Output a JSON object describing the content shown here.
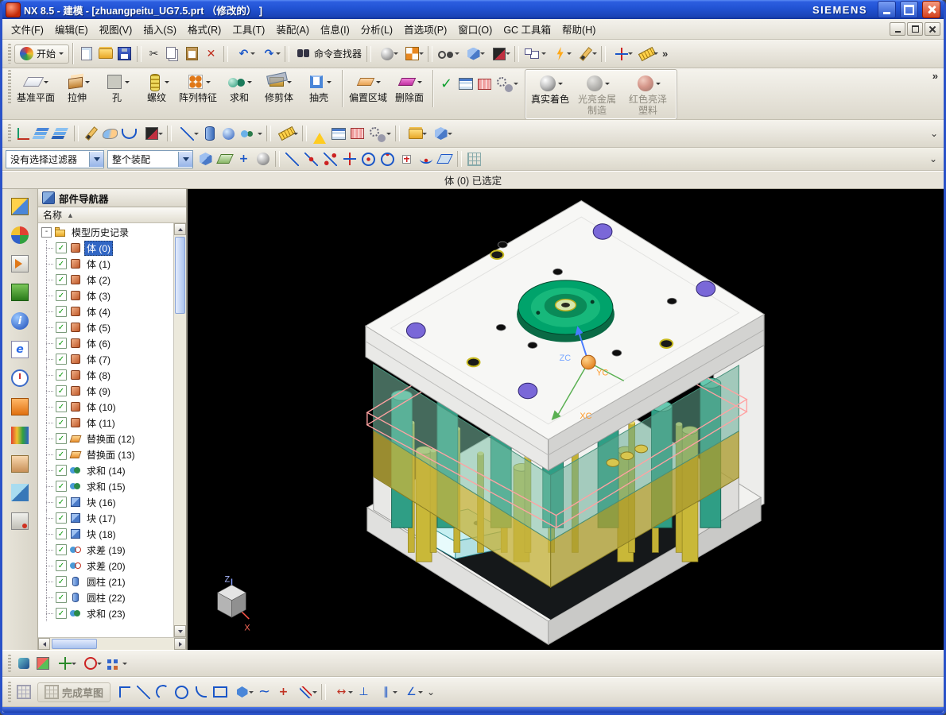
{
  "colors": {
    "frame": "#2a52c8",
    "titlebar": "#2152d2",
    "toolbar_bg": "#e6e3d8",
    "viewport_bg": "#000000",
    "selection_blue": "#3166c4",
    "locating_ring_green": "#00a36b",
    "mold_teal": "#6fb8a0",
    "mold_yellow": "#c4b43c",
    "highlight_pink": "#ffa2a2"
  },
  "glyphs": {
    "dropdown": "▾",
    "overflow": "»",
    "more": "⌄",
    "check": "✓",
    "collapse": "-",
    "sort": "▲"
  },
  "window": {
    "title": "NX 8.5 - 建模 - [zhuangpeitu_UG7.5.prt （修改的） ]",
    "brand": "SIEMENS"
  },
  "menu": {
    "items": [
      {
        "label": "文件(F)"
      },
      {
        "label": "编辑(E)"
      },
      {
        "label": "视图(V)"
      },
      {
        "label": "插入(S)"
      },
      {
        "label": "格式(R)"
      },
      {
        "label": "工具(T)"
      },
      {
        "label": "装配(A)"
      },
      {
        "label": "信息(I)"
      },
      {
        "label": "分析(L)"
      },
      {
        "label": "首选项(P)"
      },
      {
        "label": "窗口(O)"
      },
      {
        "label": "GC 工具箱"
      },
      {
        "label": "帮助(H)"
      }
    ]
  },
  "toolbar_standard": {
    "start_label": "开始",
    "command_finder_label": "命令查找器",
    "file_icons": [
      {
        "name": "new-file-icon",
        "cls": "bg-page"
      },
      {
        "name": "open-icon",
        "cls": "bg-folder"
      },
      {
        "name": "save-icon",
        "cls": "bg-save"
      },
      {
        "name": "separator",
        "cls": "sep"
      },
      {
        "name": "cut-icon",
        "cls": "i-glyph c-dark",
        "g": "✂"
      },
      {
        "name": "copy-icon",
        "cls": "bg-copy"
      },
      {
        "name": "paste-icon",
        "cls": "bg-paste"
      },
      {
        "name": "delete-icon",
        "cls": "i-glyph c-red bold",
        "g": "✕"
      },
      {
        "name": "separator",
        "cls": "sep"
      },
      {
        "name": "undo-icon",
        "cls": "i-glyph c-blue bold dd",
        "g": "↶"
      },
      {
        "name": "redo-icon",
        "cls": "i-glyph c-blue bold dd",
        "g": "↷"
      },
      {
        "name": "separator",
        "cls": "sep"
      }
    ],
    "view_icons": [
      {
        "name": "separator",
        "cls": "sep"
      },
      {
        "name": "rendering-style-icon",
        "cls": "bg-sphere dd"
      },
      {
        "name": "layout-views-icon",
        "cls": "bg-grid4 dd"
      },
      {
        "name": "separator",
        "cls": "sep"
      },
      {
        "name": "show-hide-icon",
        "cls": "bg-glasses dd"
      },
      {
        "name": "layer-settings-icon",
        "cls": "bg-cube dd"
      },
      {
        "name": "edit-object-display-icon",
        "cls": "bg-swatch dd"
      },
      {
        "name": "separator",
        "cls": "sep"
      },
      {
        "name": "window-layout-icon",
        "cls": "bg-windows dd"
      },
      {
        "name": "synchronous-modeling-icon",
        "cls": "bg-flash dd"
      },
      {
        "name": "sketch-icon",
        "cls": "bg-pencil dd"
      },
      {
        "name": "separator",
        "cls": "sep"
      },
      {
        "name": "snap-point-icon",
        "cls": "bg-snapint dd"
      },
      {
        "name": "measure-icon",
        "cls": "bg-ruler dd"
      }
    ]
  },
  "toolbar_feature": {
    "buttons": [
      {
        "label": "基准平面",
        "icon": "fi-datum",
        "name": "datum-plane-button"
      },
      {
        "label": "拉伸",
        "icon": "fi-extrude",
        "name": "extrude-button"
      },
      {
        "label": "孔",
        "icon": "fi-hole",
        "name": "hole-button"
      },
      {
        "label": "螺纹",
        "icon": "fi-thread",
        "name": "thread-button"
      },
      {
        "label": "阵列特征",
        "icon": "fi-pattern",
        "name": "pattern-feature-button"
      },
      {
        "label": "求和",
        "icon": "fi-unite",
        "name": "unite-button"
      },
      {
        "label": "修剪体",
        "icon": "fi-trim",
        "name": "trim-body-button"
      },
      {
        "label": "抽壳",
        "icon": "fi-shell",
        "name": "shell-button"
      }
    ],
    "buttons2": [
      {
        "label": "偏置区域",
        "icon": "fi-offset",
        "name": "offset-region-button"
      },
      {
        "label": "删除面",
        "icon": "fi-delface",
        "name": "delete-face-button"
      }
    ],
    "mid_icons": [
      {
        "name": "check-mark-icon",
        "cls": "i-glyph c-green big bold",
        "g": "✓"
      },
      {
        "name": "expressions-table-icon",
        "cls": "bg-table"
      },
      {
        "name": "part-family-table-icon",
        "cls": "bg-grid-red"
      },
      {
        "name": "interpart-link-icon",
        "cls": "bg-gears dd"
      }
    ],
    "shading": [
      {
        "label": "真实着色",
        "icon": "fi-shade-real",
        "name": "true-shading-button"
      },
      {
        "label": "光亮金属制造",
        "icon": "fi-shade-metal",
        "name": "shiny-metal-button",
        "disabled": true
      },
      {
        "label": "红色亮泽塑料",
        "icon": "fi-shade-red",
        "name": "red-glossy-plastic-button",
        "disabled": true
      }
    ]
  },
  "toolbar_utility": {
    "icons": [
      {
        "name": "datum-csys-icon",
        "cls": "bg-csys"
      },
      {
        "name": "layer-settings-icon",
        "cls": "bg-layers"
      },
      {
        "name": "visible-in-view-icon",
        "cls": "bg-layers2"
      },
      {
        "name": "separator",
        "cls": "sep"
      },
      {
        "name": "sketch-curve-icon",
        "cls": "bg-pencil"
      },
      {
        "name": "studio-surface-icon",
        "cls": "bg-swoosh"
      },
      {
        "name": "through-curves-icon",
        "cls": "bg-curves"
      },
      {
        "name": "edit-display-icon",
        "cls": "bg-swatch dd"
      },
      {
        "name": "separator",
        "cls": "sep"
      },
      {
        "name": "line-tool-icon",
        "cls": "bg-snapline dd"
      },
      {
        "name": "cylinder-tool-icon",
        "cls": "bg-cylblue"
      },
      {
        "name": "sphere-tool-icon",
        "cls": "bg-sphereblue"
      },
      {
        "name": "boolean-tool-icon",
        "cls": "bg-bool dd"
      },
      {
        "name": "separator",
        "cls": "sep"
      },
      {
        "name": "measure-distance-icon",
        "cls": "bg-ruler dd"
      },
      {
        "name": "separator",
        "cls": "sep"
      },
      {
        "name": "model-check-icon",
        "cls": "bg-warn"
      },
      {
        "name": "expressions-icon",
        "cls": "bg-table"
      },
      {
        "name": "part-families-icon",
        "cls": "bg-grid-red"
      },
      {
        "name": "gear-link-icon",
        "cls": "bg-gears dd"
      },
      {
        "name": "separator",
        "cls": "sep"
      },
      {
        "name": "sequence-icon",
        "cls": "bg-folder dd"
      },
      {
        "name": "wave-geometry-icon",
        "cls": "bg-cube dd"
      }
    ]
  },
  "selection_bar": {
    "filter_label": "没有选择过滤器",
    "scope_label": "整个装配",
    "icons": [
      {
        "name": "object-type-filter-icon",
        "cls": "bg-cube"
      },
      {
        "name": "face-rule-icon",
        "cls": "bg-faceplane"
      },
      {
        "name": "stop-at-intersection-icon",
        "cls": "i-glyph c-blue bold",
        "g": "+"
      },
      {
        "name": "highlight-selection-icon",
        "cls": "bg-sphere"
      },
      {
        "name": "separator",
        "cls": "sep"
      },
      {
        "name": "snap-endpoint-icon",
        "cls": "bg-snapline"
      },
      {
        "name": "snap-midpoint-icon",
        "cls": "bg-snapmid"
      },
      {
        "name": "snap-control-point-icon",
        "cls": "bg-snapctrl"
      },
      {
        "name": "snap-intersection-icon",
        "cls": "bg-snapint"
      },
      {
        "name": "snap-arc-center-icon",
        "cls": "bg-snapcen"
      },
      {
        "name": "snap-quadrant-icon",
        "cls": "bg-snapquad"
      },
      {
        "name": "snap-existing-point-icon",
        "cls": "bg-snappt"
      },
      {
        "name": "snap-point-on-curve-icon",
        "cls": "bg-snapcrv"
      },
      {
        "name": "snap-point-on-face-icon",
        "cls": "bg-snapface"
      },
      {
        "name": "separator",
        "cls": "sep"
      },
      {
        "name": "snap-grid-icon",
        "cls": "bg-gridsnap"
      }
    ]
  },
  "prompt_bar": {
    "text": "体 (0) 已选定"
  },
  "resource_bar": {
    "icons": [
      {
        "name": "assembly-navigator-icon",
        "cls": "r-asm"
      },
      {
        "name": "constraint-navigator-icon",
        "cls": "r-con"
      },
      {
        "name": "part-navigator-icon",
        "cls": "r-part"
      },
      {
        "name": "reuse-library-icon",
        "cls": "r-reuse"
      },
      {
        "name": "hd3d-tools-icon",
        "cls": "r-hd3d",
        "g": "i"
      },
      {
        "name": "web-browser-icon",
        "cls": "r-web",
        "g": "e"
      },
      {
        "name": "history-icon",
        "cls": "r-history"
      },
      {
        "name": "process-studio-icon",
        "cls": "r-process"
      },
      {
        "name": "manufacturing-wizard-icon",
        "cls": "r-mfg"
      },
      {
        "name": "roles-icon",
        "cls": "r-roles"
      },
      {
        "name": "system-scenes-icon",
        "cls": "r-scenes"
      },
      {
        "name": "touch-mode-icon",
        "cls": "r-touch"
      }
    ]
  },
  "navigator": {
    "title": "部件导航器",
    "column": "名称",
    "root_label": "模型历史记录",
    "items": [
      {
        "label": "体 (0)",
        "icon": "tn-body",
        "selected": true
      },
      {
        "label": "体 (1)",
        "icon": "tn-body"
      },
      {
        "label": "体 (2)",
        "icon": "tn-body"
      },
      {
        "label": "体 (3)",
        "icon": "tn-body"
      },
      {
        "label": "体 (4)",
        "icon": "tn-body"
      },
      {
        "label": "体 (5)",
        "icon": "tn-body"
      },
      {
        "label": "体 (6)",
        "icon": "tn-body"
      },
      {
        "label": "体 (7)",
        "icon": "tn-body"
      },
      {
        "label": "体 (8)",
        "icon": "tn-body"
      },
      {
        "label": "体 (9)",
        "icon": "tn-body"
      },
      {
        "label": "体 (10)",
        "icon": "tn-body"
      },
      {
        "label": "体 (11)",
        "icon": "tn-body"
      },
      {
        "label": "替换面 (12)",
        "icon": "tn-face"
      },
      {
        "label": "替换面 (13)",
        "icon": "tn-face"
      },
      {
        "label": "求和 (14)",
        "icon": "tn-unite"
      },
      {
        "label": "求和 (15)",
        "icon": "tn-unite"
      },
      {
        "label": "块 (16)",
        "icon": "tn-block"
      },
      {
        "label": "块 (17)",
        "icon": "tn-block"
      },
      {
        "label": "块 (18)",
        "icon": "tn-block"
      },
      {
        "label": "求差 (19)",
        "icon": "tn-subtract"
      },
      {
        "label": "求差 (20)",
        "icon": "tn-subtract"
      },
      {
        "label": "圆柱 (21)",
        "icon": "tn-cyl"
      },
      {
        "label": "圆柱 (22)",
        "icon": "tn-cyl"
      },
      {
        "label": "求和 (23)",
        "icon": "tn-unite"
      }
    ]
  },
  "viewport": {
    "axes": {
      "zc": "ZC",
      "yc": "YC",
      "xc": "XC",
      "z": "Z",
      "x": "X"
    }
  },
  "assembly_bar": {
    "icons": [
      {
        "name": "find-component-icon",
        "cls": "bg-findcomp"
      },
      {
        "name": "component-display-icon",
        "cls": "bg-compdisp"
      },
      {
        "name": "move-component-icon",
        "cls": "bg-move dd"
      },
      {
        "name": "assembly-constraints-icon",
        "cls": "bg-dof dd"
      },
      {
        "name": "exploded-view-icon",
        "cls": "bg-explode dd"
      }
    ]
  },
  "sketch_bar": {
    "finish_label": "完成草图",
    "icons": [
      {
        "name": "profile-icon",
        "cls": "s-profile"
      },
      {
        "name": "line-icon",
        "cls": "s-line"
      },
      {
        "name": "arc-icon",
        "cls": "s-arc"
      },
      {
        "name": "circle-icon",
        "cls": "s-circle"
      },
      {
        "name": "fillet-icon",
        "cls": "s-fillet"
      },
      {
        "name": "rectangle-icon",
        "cls": "s-rect"
      },
      {
        "name": "polygon-icon",
        "cls": "s-poly dd"
      },
      {
        "name": "studio-spline-icon",
        "cls": "i-glyph c-blue big",
        "g": "~"
      },
      {
        "name": "point-icon",
        "cls": "i-glyph c-red bold",
        "g": "+"
      },
      {
        "name": "offset-curve-icon",
        "cls": "s-offset dd"
      },
      {
        "name": "separator",
        "cls": "sep"
      },
      {
        "name": "rapid-dimension-icon",
        "cls": "i-glyph c-red dd",
        "g": "↔"
      },
      {
        "name": "geometric-constraint-icon",
        "cls": "i-glyph c-blue",
        "g": "⊥"
      },
      {
        "name": "make-symmetric-icon",
        "cls": "i-glyph c-blue dd",
        "g": "∥"
      },
      {
        "name": "display-constraint-icon",
        "cls": "i-glyph c-blue dd",
        "g": "∠"
      }
    ]
  }
}
